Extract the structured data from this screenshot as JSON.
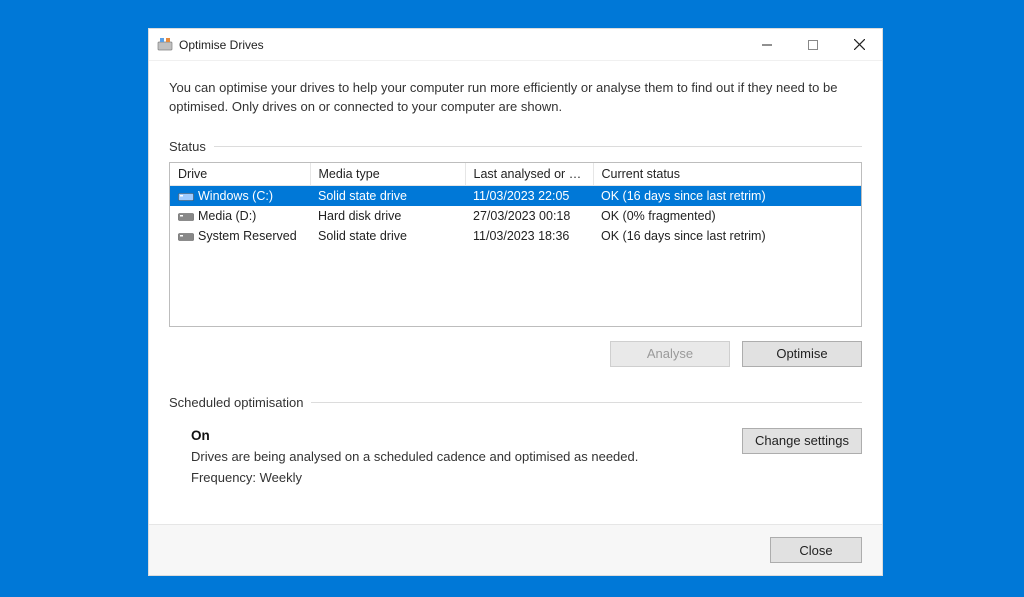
{
  "window": {
    "title": "Optimise Drives"
  },
  "intro": "You can optimise your drives to help your computer run more efficiently or analyse them to find out if they need to be optimised. Only drives on or connected to your computer are shown.",
  "status": {
    "label": "Status",
    "columns": {
      "drive": "Drive",
      "media": "Media type",
      "analysed": "Last analysed or o...",
      "current": "Current status"
    },
    "rows": [
      {
        "name": "Windows (C:)",
        "media": "Solid state drive",
        "analysed": "11/03/2023 22:05",
        "status": "OK (16 days since last retrim)",
        "selected": true,
        "iconColor": "#1e90ff"
      },
      {
        "name": "Media (D:)",
        "media": "Hard disk drive",
        "analysed": "27/03/2023 00:18",
        "status": "OK (0% fragmented)",
        "selected": false,
        "iconColor": "#888888"
      },
      {
        "name": "System Reserved",
        "media": "Solid state drive",
        "analysed": "11/03/2023 18:36",
        "status": "OK (16 days since last retrim)",
        "selected": false,
        "iconColor": "#888888"
      }
    ]
  },
  "buttons": {
    "analyse": "Analyse",
    "optimise": "Optimise",
    "change_settings": "Change settings",
    "close": "Close"
  },
  "scheduled": {
    "label": "Scheduled optimisation",
    "state": "On",
    "desc": "Drives are being analysed on a scheduled cadence and optimised as needed.",
    "freq": "Frequency: Weekly"
  }
}
